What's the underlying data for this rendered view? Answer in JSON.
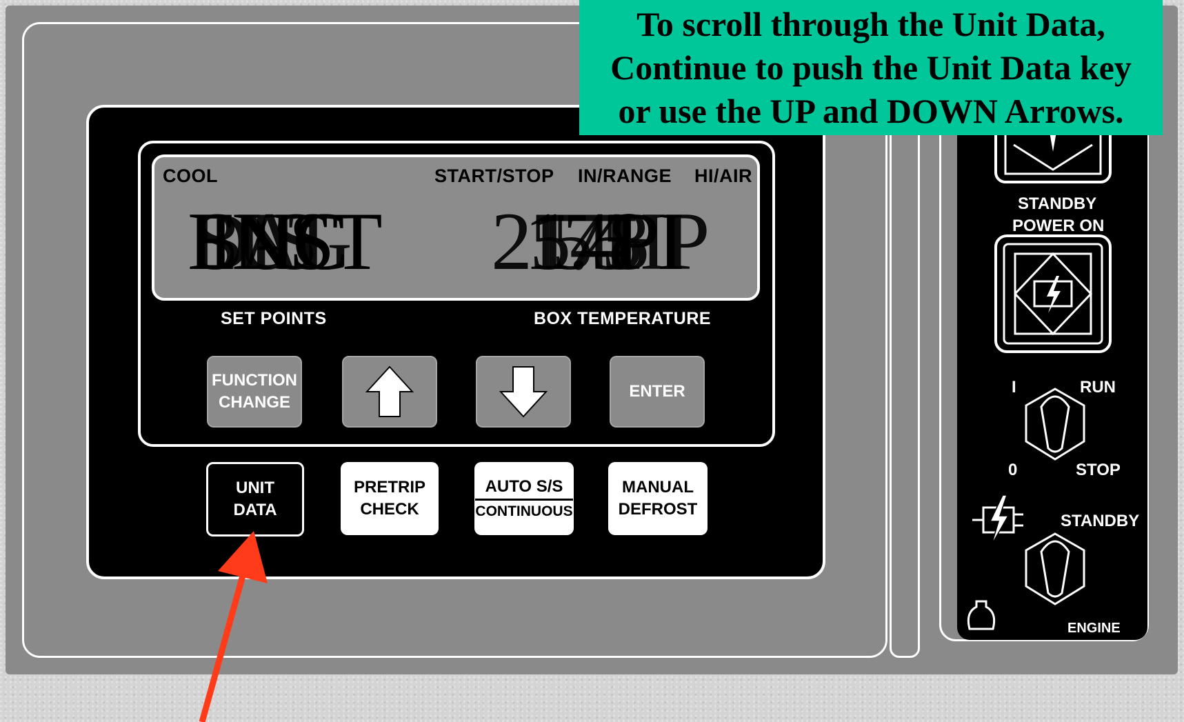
{
  "callout": {
    "lines": [
      "To scroll through the Unit Data,",
      "Continue to push the Unit Data key",
      "or use the UP and DOWN Arrows."
    ],
    "color": "#00c79a"
  },
  "lcd": {
    "indicators": {
      "cool": "COOL",
      "start_stop": "START/STOP",
      "in_range": "IN/RANGE",
      "hi_air": "HI/AIR"
    },
    "left_readout_overlaid": [
      "BAT",
      "SUC",
      "ENG",
      "DIS",
      "INST"
    ],
    "right_readout_overlaid": [
      "25.4",
      "175",
      "148",
      "55",
      "HP",
      "PI"
    ]
  },
  "panel": {
    "set_points_label": "SET POINTS",
    "box_temperature_label": "BOX TEMPERATURE",
    "keys_row1": {
      "function_change": [
        "FUNCTION",
        "CHANGE"
      ],
      "up_arrow_icon": "up-arrow-icon",
      "down_arrow_icon": "down-arrow-icon",
      "enter": "ENTER"
    },
    "keys_row2": {
      "unit_data": [
        "UNIT",
        "DATA"
      ],
      "pretrip_check": [
        "PRETRIP",
        "CHECK"
      ],
      "auto_ss": [
        "AUTO S/S",
        "CONTINUOUS"
      ],
      "manual_defrost": [
        "MANUAL",
        "DEFROST"
      ]
    }
  },
  "side": {
    "standby_power_on": [
      "STANDBY",
      "POWER ON"
    ],
    "switch1": {
      "on": "I",
      "off": "0",
      "run": "RUN",
      "stop": "STOP"
    },
    "standby": "STANDBY",
    "engine": "ENGINE"
  },
  "colors": {
    "housing": "#8a8a8a",
    "panel": "#000000",
    "lcd": "#8c8c8c",
    "arrow": "#ff3b1a"
  }
}
